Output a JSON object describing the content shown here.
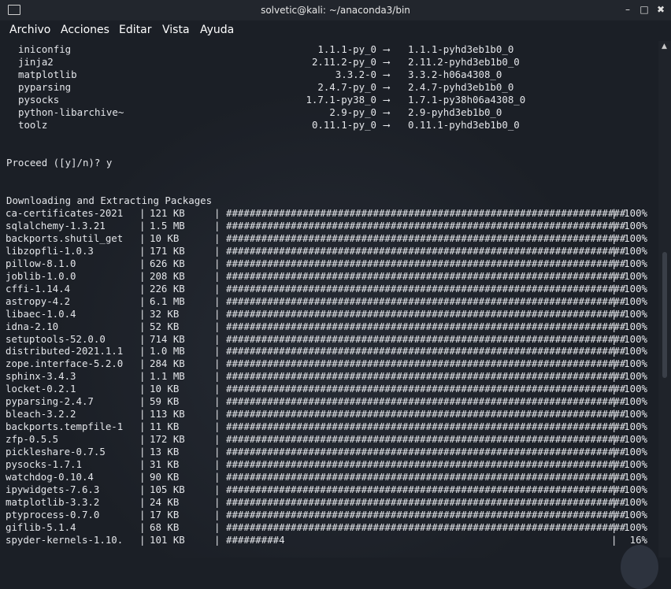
{
  "window": {
    "title": "solvetic@kali: ~/anaconda3/bin",
    "minimize_label": "–",
    "maximize_label": "□",
    "close_label": "✖"
  },
  "menu": {
    "items": [
      "Archivo",
      "Acciones",
      "Editar",
      "Vista",
      "Ayuda"
    ]
  },
  "updates": [
    {
      "name": "iniconfig",
      "old": "1.1.1-py_0",
      "arrow": "⟶",
      "new": "1.1.1-pyhd3eb1b0_0"
    },
    {
      "name": "jinja2",
      "old": "2.11.2-py_0",
      "arrow": "⟶",
      "new": "2.11.2-pyhd3eb1b0_0"
    },
    {
      "name": "matplotlib",
      "old": "3.3.2-0",
      "arrow": "⟶",
      "new": "3.3.2-h06a4308_0"
    },
    {
      "name": "pyparsing",
      "old": "2.4.7-py_0",
      "arrow": "⟶",
      "new": "2.4.7-pyhd3eb1b0_0"
    },
    {
      "name": "pysocks",
      "old": "1.7.1-py38_0",
      "arrow": "⟶",
      "new": "1.7.1-py38h06a4308_0"
    },
    {
      "name": "python-libarchive~",
      "old": "2.9-py_0",
      "arrow": "⟶",
      "new": "2.9-pyhd3eb1b0_0"
    },
    {
      "name": "toolz",
      "old": "0.11.1-py_0",
      "arrow": "⟶",
      "new": "0.11.1-pyhd3eb1b0_0"
    }
  ],
  "prompt": "Proceed ([y]/n)? y",
  "downloading_header": "Downloading and Extracting Packages",
  "separator": "|",
  "full_bar": "####################################################################",
  "packages": [
    {
      "name": "ca-certificates-2021",
      "size": "121 KB",
      "bar": "####################################################################",
      "pct": "100%"
    },
    {
      "name": "sqlalchemy-1.3.21",
      "size": "1.5 MB",
      "bar": "####################################################################",
      "pct": "100%"
    },
    {
      "name": "backports.shutil_get",
      "size": "10 KB",
      "bar": "####################################################################",
      "pct": "100%"
    },
    {
      "name": "libzopfli-1.0.3",
      "size": "171 KB",
      "bar": "####################################################################",
      "pct": "100%"
    },
    {
      "name": "pillow-8.1.0",
      "size": "626 KB",
      "bar": "####################################################################",
      "pct": "100%"
    },
    {
      "name": "joblib-1.0.0",
      "size": "208 KB",
      "bar": "####################################################################",
      "pct": "100%"
    },
    {
      "name": "cffi-1.14.4",
      "size": "226 KB",
      "bar": "####################################################################",
      "pct": "100%"
    },
    {
      "name": "astropy-4.2",
      "size": "6.1 MB",
      "bar": "####################################################################",
      "pct": "100%"
    },
    {
      "name": "libaec-1.0.4",
      "size": "32 KB",
      "bar": "####################################################################",
      "pct": "100%"
    },
    {
      "name": "idna-2.10",
      "size": "52 KB",
      "bar": "####################################################################",
      "pct": "100%"
    },
    {
      "name": "setuptools-52.0.0",
      "size": "714 KB",
      "bar": "####################################################################",
      "pct": "100%"
    },
    {
      "name": "distributed-2021.1.1",
      "size": "1.0 MB",
      "bar": "####################################################################",
      "pct": "100%"
    },
    {
      "name": "zope.interface-5.2.0",
      "size": "284 KB",
      "bar": "####################################################################",
      "pct": "100%"
    },
    {
      "name": "sphinx-3.4.3",
      "size": "1.1 MB",
      "bar": "####################################################################",
      "pct": "100%"
    },
    {
      "name": "locket-0.2.1",
      "size": "10 KB",
      "bar": "####################################################################",
      "pct": "100%"
    },
    {
      "name": "pyparsing-2.4.7",
      "size": "59 KB",
      "bar": "####################################################################",
      "pct": "100%"
    },
    {
      "name": "bleach-3.2.2",
      "size": "113 KB",
      "bar": "####################################################################",
      "pct": "100%"
    },
    {
      "name": "backports.tempfile-1",
      "size": "11 KB",
      "bar": "####################################################################",
      "pct": "100%"
    },
    {
      "name": "zfp-0.5.5",
      "size": "172 KB",
      "bar": "####################################################################",
      "pct": "100%"
    },
    {
      "name": "pickleshare-0.7.5",
      "size": "13 KB",
      "bar": "####################################################################",
      "pct": "100%"
    },
    {
      "name": "pysocks-1.7.1",
      "size": "31 KB",
      "bar": "####################################################################",
      "pct": "100%"
    },
    {
      "name": "watchdog-0.10.4",
      "size": "90 KB",
      "bar": "####################################################################",
      "pct": "100%"
    },
    {
      "name": "ipywidgets-7.6.3",
      "size": "105 KB",
      "bar": "####################################################################",
      "pct": "100%"
    },
    {
      "name": "matplotlib-3.3.2",
      "size": "24 KB",
      "bar": "####################################################################",
      "pct": "100%"
    },
    {
      "name": "ptyprocess-0.7.0",
      "size": "17 KB",
      "bar": "####################################################################",
      "pct": "100%"
    },
    {
      "name": "giflib-5.1.4",
      "size": "68 KB",
      "bar": "####################################################################",
      "pct": "100%"
    },
    {
      "name": "spyder-kernels-1.10.",
      "size": "101 KB",
      "bar": "#########4",
      "pct": "16%"
    }
  ]
}
